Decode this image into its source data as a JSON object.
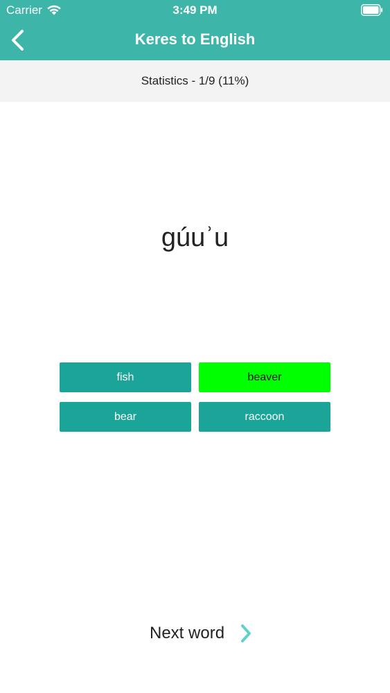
{
  "status_bar": {
    "carrier": "Carrier",
    "time": "3:49 PM"
  },
  "nav": {
    "title": "Keres to English",
    "back_icon": "chevron-left-icon"
  },
  "stats": {
    "text": "Statistics - 1/9 (11%)"
  },
  "quiz": {
    "word": "gúuʾu",
    "answers": [
      "fish",
      "beaver",
      "bear",
      "raccoon"
    ],
    "correct_answer": "beaver"
  },
  "footer": {
    "next_label": "Next word",
    "next_icon": "chevron-right-icon"
  },
  "colors": {
    "header": "#3db6a9",
    "answer_button": "#1aa598",
    "correct_highlight": "#00ff00",
    "next_chevron": "#5fd3c9"
  }
}
